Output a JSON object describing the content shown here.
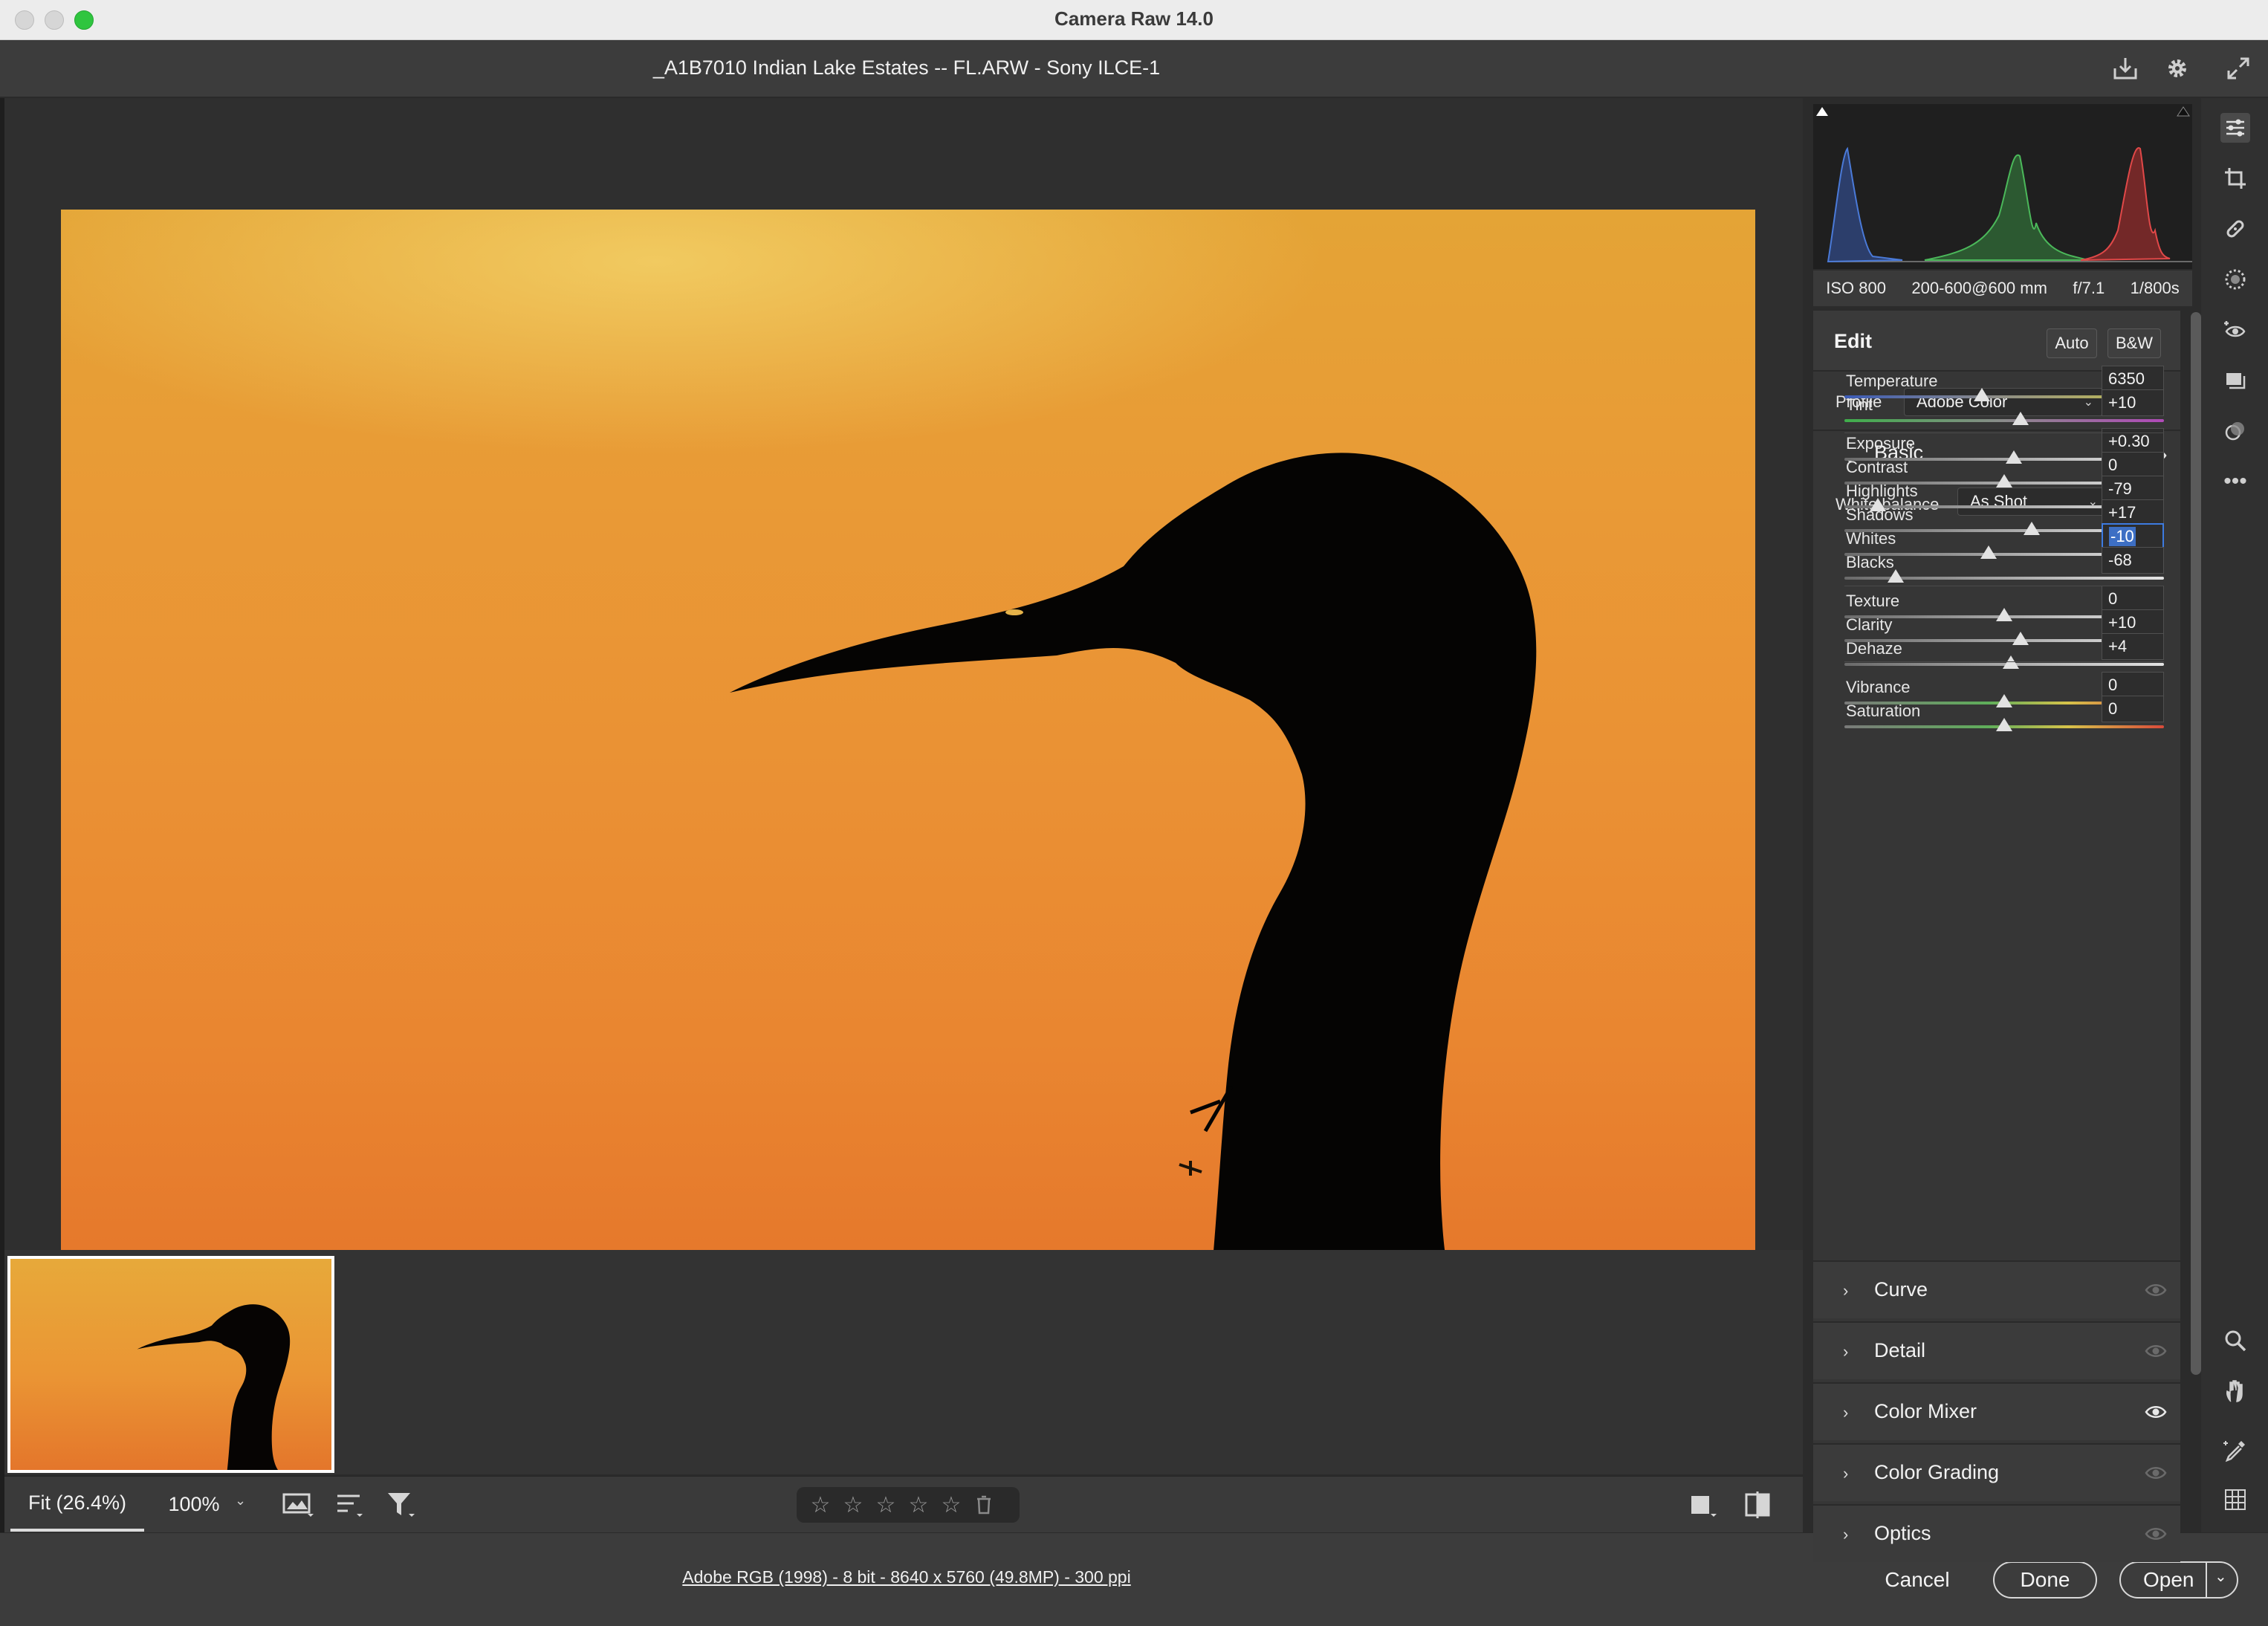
{
  "window": {
    "app_title": "Camera Raw 14.0"
  },
  "document": {
    "title": "_A1B7010 Indian Lake Estates -- FL.ARW  -  Sony ILCE-1",
    "workflow_options": "Adobe RGB (1998) - 8 bit - 8640 x 5760 (49.8MP) - 300 ppi"
  },
  "header_icons": [
    "save-icon",
    "settings-gear-icon",
    "fullscreen-icon"
  ],
  "camera_info": {
    "iso": "ISO 800",
    "lens": "200-600@600 mm",
    "aperture": "f/7.1",
    "shutter": "1/800s"
  },
  "edit": {
    "title": "Edit",
    "auto_label": "Auto",
    "bw_label": "B&W",
    "profile_label": "Profile",
    "profile_value": "Adobe Color"
  },
  "basic": {
    "title": "Basic",
    "white_balance_label": "White balance",
    "white_balance_value": "As Shot",
    "sliders": [
      {
        "label": "Temperature",
        "value": "6350",
        "position": 0.43,
        "track": "temperature"
      },
      {
        "label": "Tint",
        "value": "+10",
        "position": 0.55,
        "track": "tint"
      },
      {
        "label": "Exposure",
        "value": "+0.30",
        "position": 0.53,
        "track": "gray"
      },
      {
        "label": "Contrast",
        "value": "0",
        "position": 0.5,
        "track": "gray"
      },
      {
        "label": "Highlights",
        "value": "-79",
        "position": 0.105,
        "track": "gray"
      },
      {
        "label": "Shadows",
        "value": "+17",
        "position": 0.585,
        "track": "gray"
      },
      {
        "label": "Whites",
        "value": "-10",
        "position": 0.45,
        "track": "gray",
        "active": true
      },
      {
        "label": "Blacks",
        "value": "-68",
        "position": 0.16,
        "track": "gray"
      },
      {
        "label": "Texture",
        "value": "0",
        "position": 0.5,
        "track": "gray"
      },
      {
        "label": "Clarity",
        "value": "+10",
        "position": 0.55,
        "track": "gray"
      },
      {
        "label": "Dehaze",
        "value": "+4",
        "position": 0.52,
        "track": "gray"
      },
      {
        "label": "Vibrance",
        "value": "0",
        "position": 0.5,
        "track": "saturation"
      },
      {
        "label": "Saturation",
        "value": "0",
        "position": 0.5,
        "track": "saturation"
      }
    ]
  },
  "sections": [
    {
      "title": "Curve",
      "visible": false
    },
    {
      "title": "Detail",
      "visible": false
    },
    {
      "title": "Color Mixer",
      "visible": true
    },
    {
      "title": "Color Grading",
      "visible": false
    },
    {
      "title": "Optics",
      "visible": false
    }
  ],
  "bottom_toolbar": {
    "fit_label": "Fit (26.4%)",
    "zoom_label": "100%",
    "stars": [
      "☆",
      "☆",
      "☆",
      "☆",
      "☆"
    ]
  },
  "footer": {
    "cancel": "Cancel",
    "done": "Done",
    "open": "Open"
  },
  "tools": [
    "edit-sliders-icon",
    "crop-icon",
    "healing-icon",
    "masking-icon",
    "red-eye-icon",
    "snapshots-icon",
    "presets-icon",
    "more-icon",
    "zoom-icon",
    "hand-icon",
    "color-sampler-icon",
    "grid-icon"
  ],
  "colors": {
    "accent": "#3d7be0",
    "panel": "#363636",
    "background": "#2b2b2b",
    "sky_top": "#e4a436",
    "sky_bottom": "#e4732a"
  }
}
